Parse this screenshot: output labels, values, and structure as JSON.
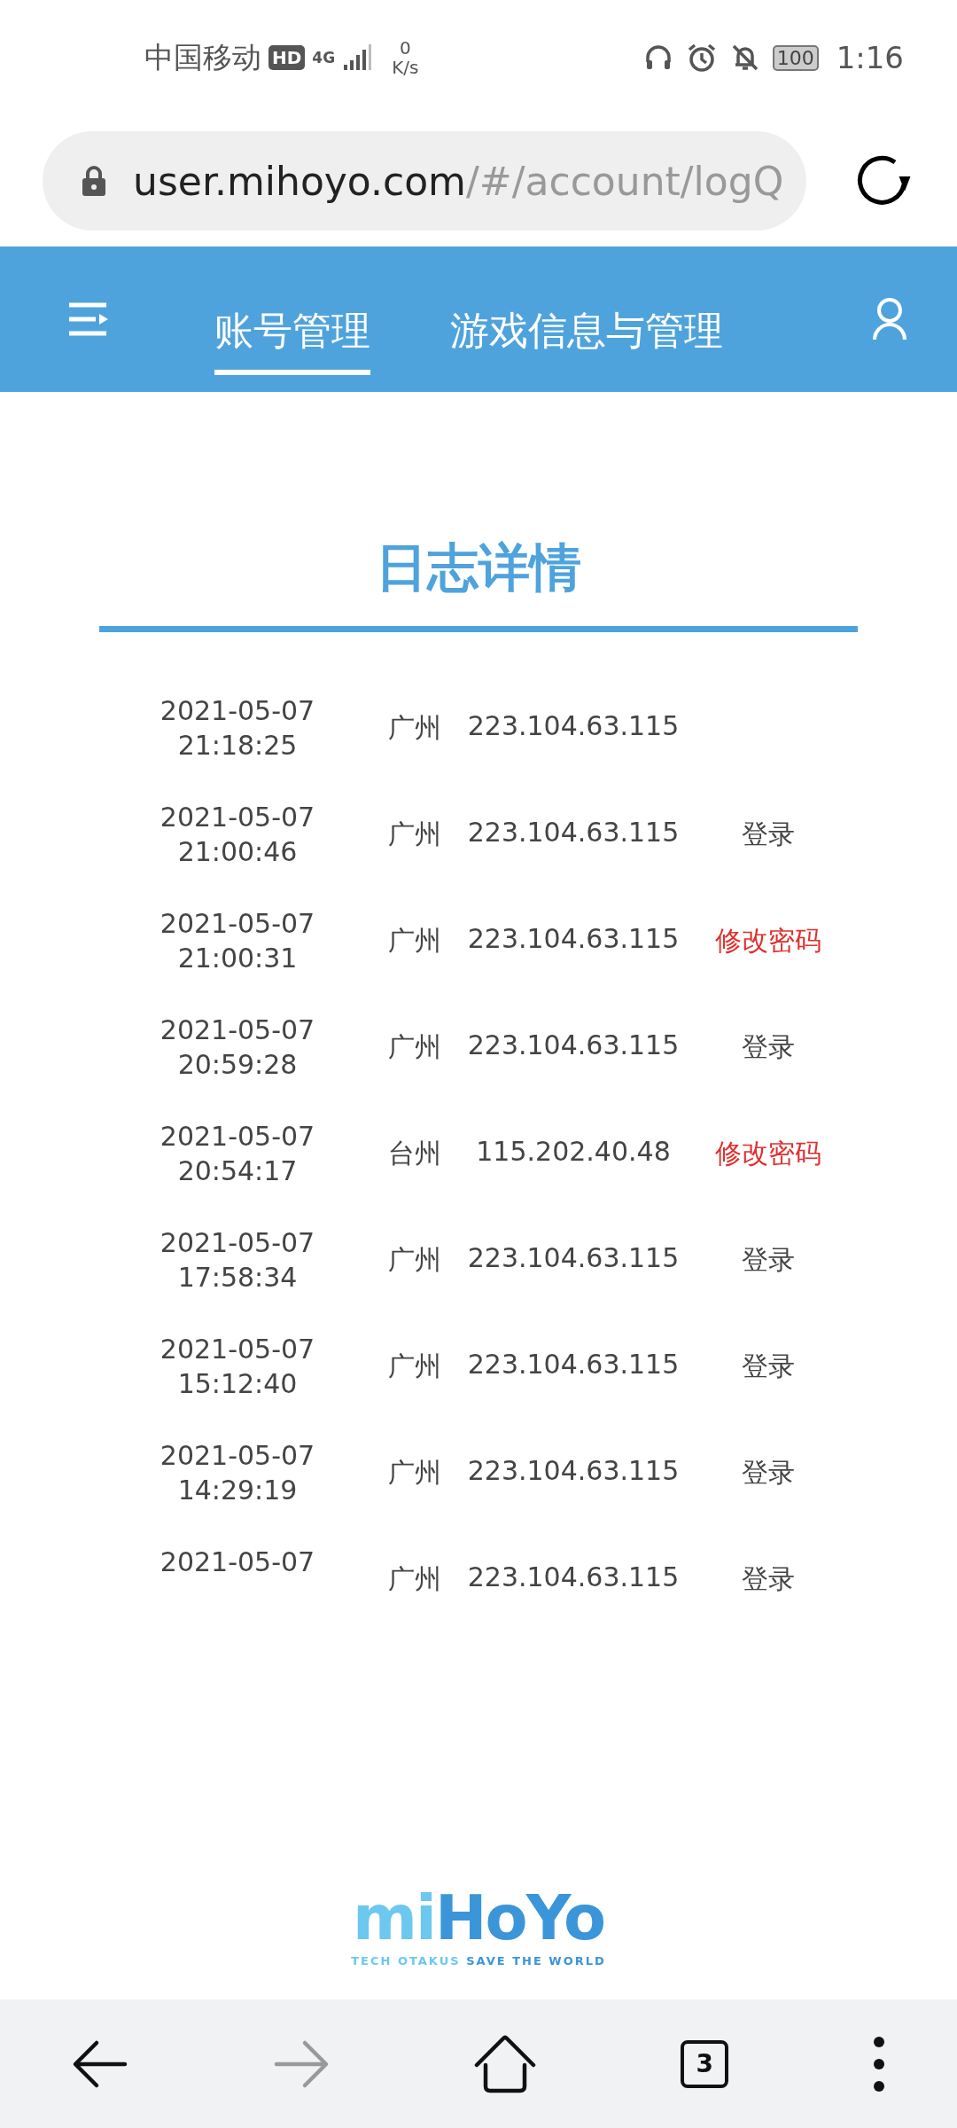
{
  "status_bar": {
    "carrier": "中国移动",
    "hd": "HD",
    "network": "4G",
    "speed_value": "0",
    "speed_unit": "K/s",
    "battery": "100",
    "time": "1:16"
  },
  "address_bar": {
    "host": "user.mihoyo.com",
    "path": "/#/account/logQ"
  },
  "nav": {
    "tabs": [
      {
        "label": "账号管理",
        "selected": true
      },
      {
        "label": "游戏信息与管理",
        "selected": false
      }
    ]
  },
  "title": "日志详情",
  "log_rows": [
    {
      "date": "2021-05-07",
      "time": "21:18:25",
      "place": "广州",
      "ip": "223.104.63.115"
    },
    {
      "date": "2021-05-07",
      "time": "21:00:46",
      "place": "广州",
      "ip": "223.104.63.115",
      "action": {
        "kind": "login",
        "text": "登录"
      }
    },
    {
      "date": "2021-05-07",
      "time": "21:00:31",
      "place": "广州",
      "ip": "223.104.63.115",
      "action": {
        "kind": "password",
        "text": "修改密码"
      }
    },
    {
      "date": "2021-05-07",
      "time": "20:59:28",
      "place": "广州",
      "ip": "223.104.63.115",
      "action": {
        "kind": "login",
        "text": "登录"
      }
    },
    {
      "date": "2021-05-07",
      "time": "20:54:17",
      "place": "台州",
      "ip": "115.202.40.48",
      "action": {
        "kind": "password",
        "text": "修改密码"
      }
    },
    {
      "date": "2021-05-07",
      "time": "17:58:34",
      "place": "广州",
      "ip": "223.104.63.115",
      "action": {
        "kind": "login",
        "text": "登录"
      }
    },
    {
      "date": "2021-05-07",
      "time": "15:12:40",
      "place": "广州",
      "ip": "223.104.63.115",
      "action": {
        "kind": "login",
        "text": "登录"
      }
    },
    {
      "date": "2021-05-07",
      "time": "14:29:19",
      "place": "广州",
      "ip": "223.104.63.115",
      "action": {
        "kind": "login",
        "text": "登录"
      }
    },
    {
      "date": "2021-05-07",
      "place": "广州",
      "ip": "223.104.63.115",
      "action": {
        "kind": "login",
        "text": "登录"
      }
    }
  ],
  "logo": {
    "wordmark_light": "mi",
    "wordmark_dark": "HoYo",
    "tagline_light": "TECH OTAKUS",
    "tagline_dark": "SAVE THE WORLD"
  },
  "browser_bar": {
    "forward_disabled": true,
    "tab_count": "3"
  }
}
